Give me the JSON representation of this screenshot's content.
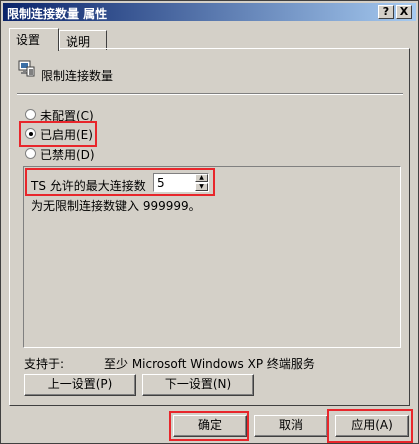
{
  "window": {
    "title": "限制连接数量 属性",
    "help_btn": "?",
    "close_btn": "X"
  },
  "tabs": [
    {
      "label": "设置"
    },
    {
      "label": "说明"
    }
  ],
  "policy": {
    "name": "限制连接数量"
  },
  "radios": [
    {
      "label": "未配置(C)",
      "checked": false
    },
    {
      "label": "已启用(E)",
      "checked": true
    },
    {
      "label": "已禁用(D)",
      "checked": false
    }
  ],
  "option": {
    "label": "TS 允许的最大连接数",
    "value": "5",
    "hint": "为无限制连接数键入 999999。"
  },
  "supported": {
    "label": "支持于:",
    "value": "至少 Microsoft Windows XP 终端服务"
  },
  "buttons": {
    "prev": "上一设置(P)",
    "next": "下一设置(N)",
    "ok": "确定",
    "cancel": "取消",
    "apply": "应用(A)"
  },
  "colors": {
    "highlight": "#e8262b",
    "face": "#d4d0c8",
    "title_start": "#0a246a",
    "title_end": "#a6caf0"
  }
}
